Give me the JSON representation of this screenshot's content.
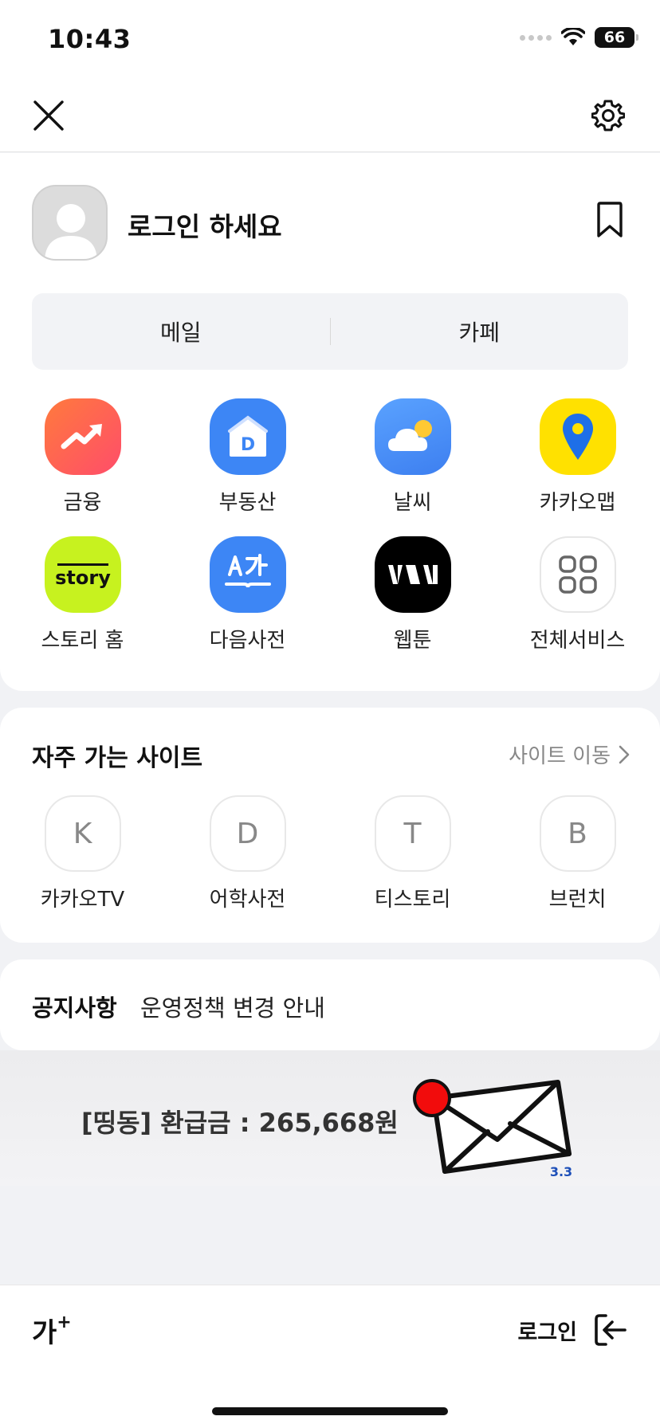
{
  "status_bar": {
    "time": "10:43",
    "battery": "66"
  },
  "profile": {
    "login_prompt": "로그인 하세요"
  },
  "quick_links": [
    {
      "label": "메일"
    },
    {
      "label": "카페"
    }
  ],
  "services": [
    {
      "label": "금융",
      "icon": "finance-icon",
      "color": "#ff5b4d"
    },
    {
      "label": "부동산",
      "icon": "real-estate-icon",
      "color": "#3d86f5"
    },
    {
      "label": "날씨",
      "icon": "weather-icon",
      "color": "#4b9af5"
    },
    {
      "label": "카카오맵",
      "icon": "kakao-map-icon",
      "color": "#ffe100"
    },
    {
      "label": "스토리 홈",
      "icon": "story-icon",
      "color": "#c7f21f"
    },
    {
      "label": "다음사전",
      "icon": "dictionary-icon",
      "color": "#3d86f5"
    },
    {
      "label": "웹툰",
      "icon": "webtoon-icon",
      "color": "#000000"
    },
    {
      "label": "전체서비스",
      "icon": "all-services-icon",
      "color": "#ffffff"
    }
  ],
  "frequent_sites": {
    "title": "자주 가는 사이트",
    "move_label": "사이트 이동",
    "items": [
      {
        "letter": "K",
        "label": "카카오TV"
      },
      {
        "letter": "D",
        "label": "어학사전"
      },
      {
        "letter": "T",
        "label": "티스토리"
      },
      {
        "letter": "B",
        "label": "브런치"
      }
    ]
  },
  "notice": {
    "title": "공지사항",
    "text": "운영정책 변경 안내"
  },
  "ad": {
    "text": "[띵동] 환급금 : 265,668원",
    "badge": "3.3"
  },
  "bottom_bar": {
    "font_size_label": "가",
    "login_label": "로그인"
  }
}
